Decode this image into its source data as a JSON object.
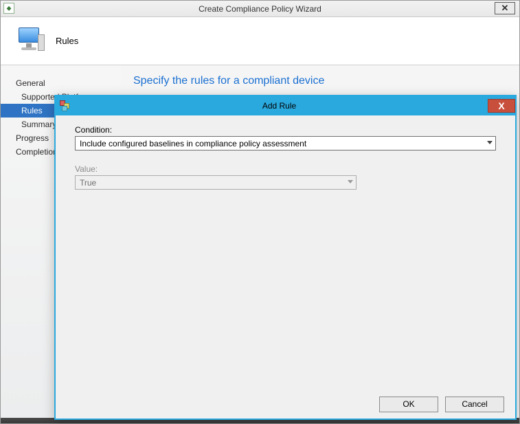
{
  "wizard": {
    "title": "Create Compliance Policy Wizard",
    "close_glyph": "✕"
  },
  "banner": {
    "title": "Rules"
  },
  "sidebar": {
    "items": [
      {
        "label": "General",
        "indent": "top"
      },
      {
        "label": "Supported Platf",
        "indent": "sub"
      },
      {
        "label": "Rules",
        "indent": "sub",
        "selected": true
      },
      {
        "label": "Summary",
        "indent": "sub"
      },
      {
        "label": "Progress",
        "indent": "top"
      },
      {
        "label": "Completion",
        "indent": "top"
      }
    ]
  },
  "main": {
    "heading": "Specify the rules for a compliant device"
  },
  "modal": {
    "title": "Add Rule",
    "close_glyph": "X",
    "condition_label": "Condition:",
    "condition_value": "Include configured baselines in compliance policy assessment",
    "value_label": "Value:",
    "value_value": "True",
    "ok_label": "OK",
    "cancel_label": "Cancel"
  }
}
